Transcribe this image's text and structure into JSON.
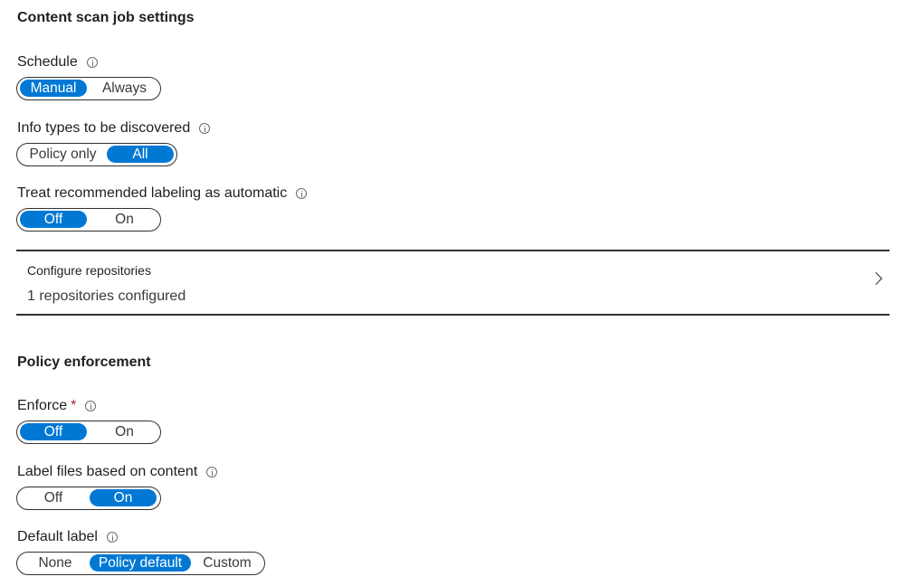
{
  "scan_settings": {
    "title": "Content scan job settings",
    "schedule": {
      "label": "Schedule",
      "options": [
        "Manual",
        "Always"
      ],
      "selected": "Manual"
    },
    "info_types": {
      "label": "Info types to be discovered",
      "options": [
        "Policy only",
        "All"
      ],
      "selected": "All"
    },
    "recommended_labeling": {
      "label": "Treat recommended labeling as automatic",
      "options": [
        "Off",
        "On"
      ],
      "selected": "Off"
    },
    "repositories": {
      "title": "Configure repositories",
      "subtitle": "1 repositories configured"
    }
  },
  "policy_enforcement": {
    "title": "Policy enforcement",
    "enforce": {
      "label": "Enforce",
      "required_mark": "*",
      "options": [
        "Off",
        "On"
      ],
      "selected": "Off"
    },
    "label_files": {
      "label": "Label files based on content",
      "options": [
        "Off",
        "On"
      ],
      "selected": "On"
    },
    "default_label": {
      "label": "Default label",
      "options": [
        "None",
        "Policy default",
        "Custom"
      ],
      "selected": "Policy default"
    }
  },
  "colors": {
    "accent": "#0078d4",
    "border": "#323130",
    "required": "#a4262c"
  },
  "icons": {
    "info": "info-icon",
    "chevron": "chevron-right-icon"
  }
}
